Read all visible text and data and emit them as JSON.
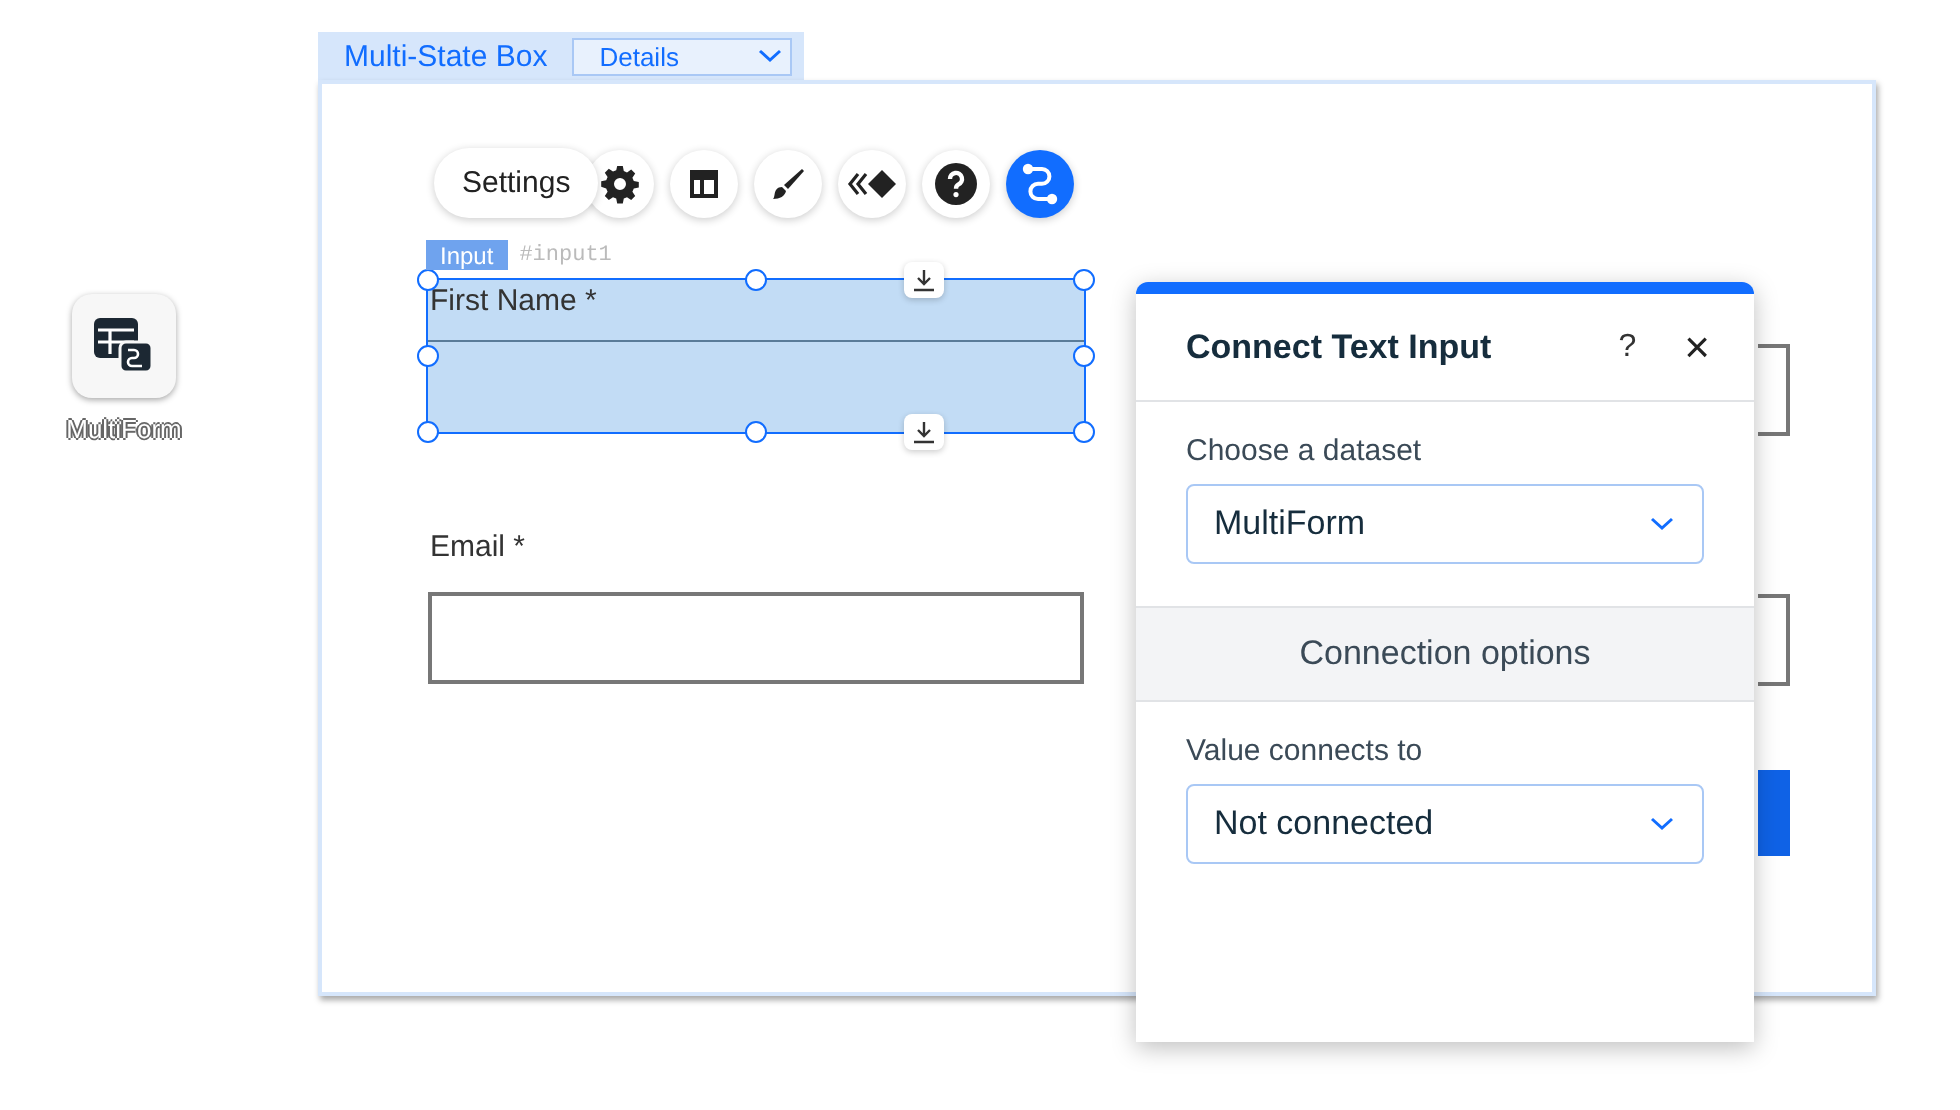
{
  "canvas_app": {
    "label": "MultiForm"
  },
  "state_box": {
    "title": "Multi-State Box",
    "state": "Details"
  },
  "toolbar": {
    "tooltip": "Settings",
    "buttons": [
      {
        "kind": "settings",
        "selected": false
      },
      {
        "kind": "layout",
        "selected": false
      },
      {
        "kind": "design",
        "selected": false
      },
      {
        "kind": "animation",
        "selected": false
      },
      {
        "kind": "help",
        "selected": false
      },
      {
        "kind": "connect",
        "selected": true
      }
    ]
  },
  "element_tag": {
    "type": "Input",
    "id": "#input1"
  },
  "form": {
    "fields": [
      {
        "label": "First Name *",
        "selected": true
      },
      {
        "label": "Email *",
        "selected": false
      }
    ]
  },
  "panel": {
    "title": "Connect Text Input",
    "help": "?",
    "close": "×",
    "dataset_label": "Choose a dataset",
    "dataset": "MultiForm",
    "section": "Connection options",
    "value_label": "Value connects to",
    "value": "Not connected"
  }
}
